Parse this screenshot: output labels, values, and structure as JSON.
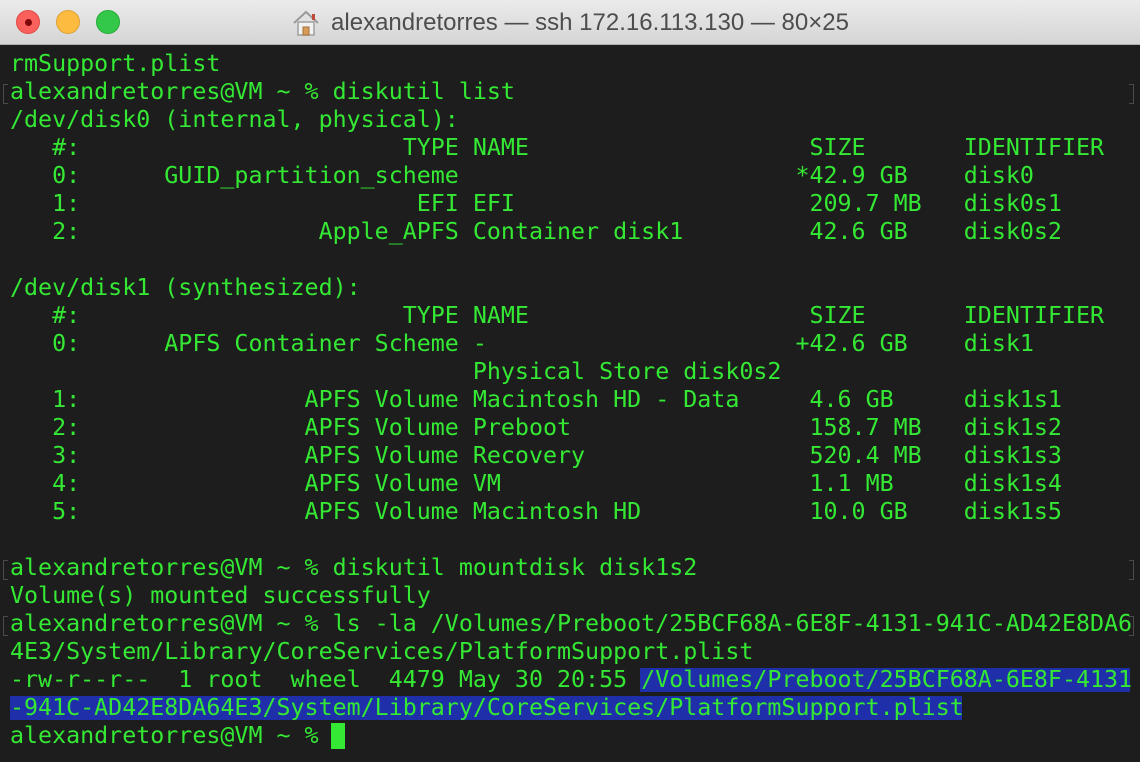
{
  "window": {
    "title": "alexandretorres — ssh 172.16.113.130 — 80×25",
    "title_icon": "home-folder-icon",
    "controls": [
      "close",
      "minimize",
      "zoom"
    ]
  },
  "colors": {
    "background": "#1d1d1d",
    "text": "#34e834",
    "selection": "#1e2fa9",
    "titlebar": "#e0e0e0"
  },
  "terminal": {
    "lines": [
      "rmSupport.plist",
      "alexandretorres@VM ~ % diskutil list",
      "/dev/disk0 (internal, physical):",
      "   #:                       TYPE NAME                    SIZE       IDENTIFIER",
      "   0:      GUID_partition_scheme                        *42.9 GB    disk0",
      "   1:                        EFI EFI                     209.7 MB   disk0s1",
      "   2:                 Apple_APFS Container disk1         42.6 GB    disk0s2",
      "",
      "/dev/disk1 (synthesized):",
      "   #:                       TYPE NAME                    SIZE       IDENTIFIER",
      "   0:      APFS Container Scheme -                      +42.6 GB    disk1",
      "                                 Physical Store disk0s2",
      "   1:                APFS Volume Macintosh HD - Data     4.6 GB     disk1s1",
      "   2:                APFS Volume Preboot                 158.7 MB   disk1s2",
      "   3:                APFS Volume Recovery                520.4 MB   disk1s3",
      "   4:                APFS Volume VM                      1.1 MB     disk1s4",
      "   5:                APFS Volume Macintosh HD            10.0 GB    disk1s5",
      "",
      "alexandretorres@VM ~ % diskutil mountdisk disk1s2",
      "Volume(s) mounted successfully",
      "alexandretorres@VM ~ % ls -la /Volumes/Preboot/25BCF68A-6E8F-4131-941C-AD42E8DA6",
      "4E3/System/Library/CoreServices/PlatformSupport.plist",
      "-rw-r--r--  1 root  wheel  4479 May 30 20:55 ",
      "-941C-AD42E8DA64E3/System/Library/CoreServices/PlatformSupport.plist",
      "alexandretorres@VM ~ % "
    ],
    "selected_text_line22": "/Volumes/Preboot/25BCF68A-6E8F-4131",
    "prompt_marked_lines": [
      1,
      18,
      20
    ]
  }
}
